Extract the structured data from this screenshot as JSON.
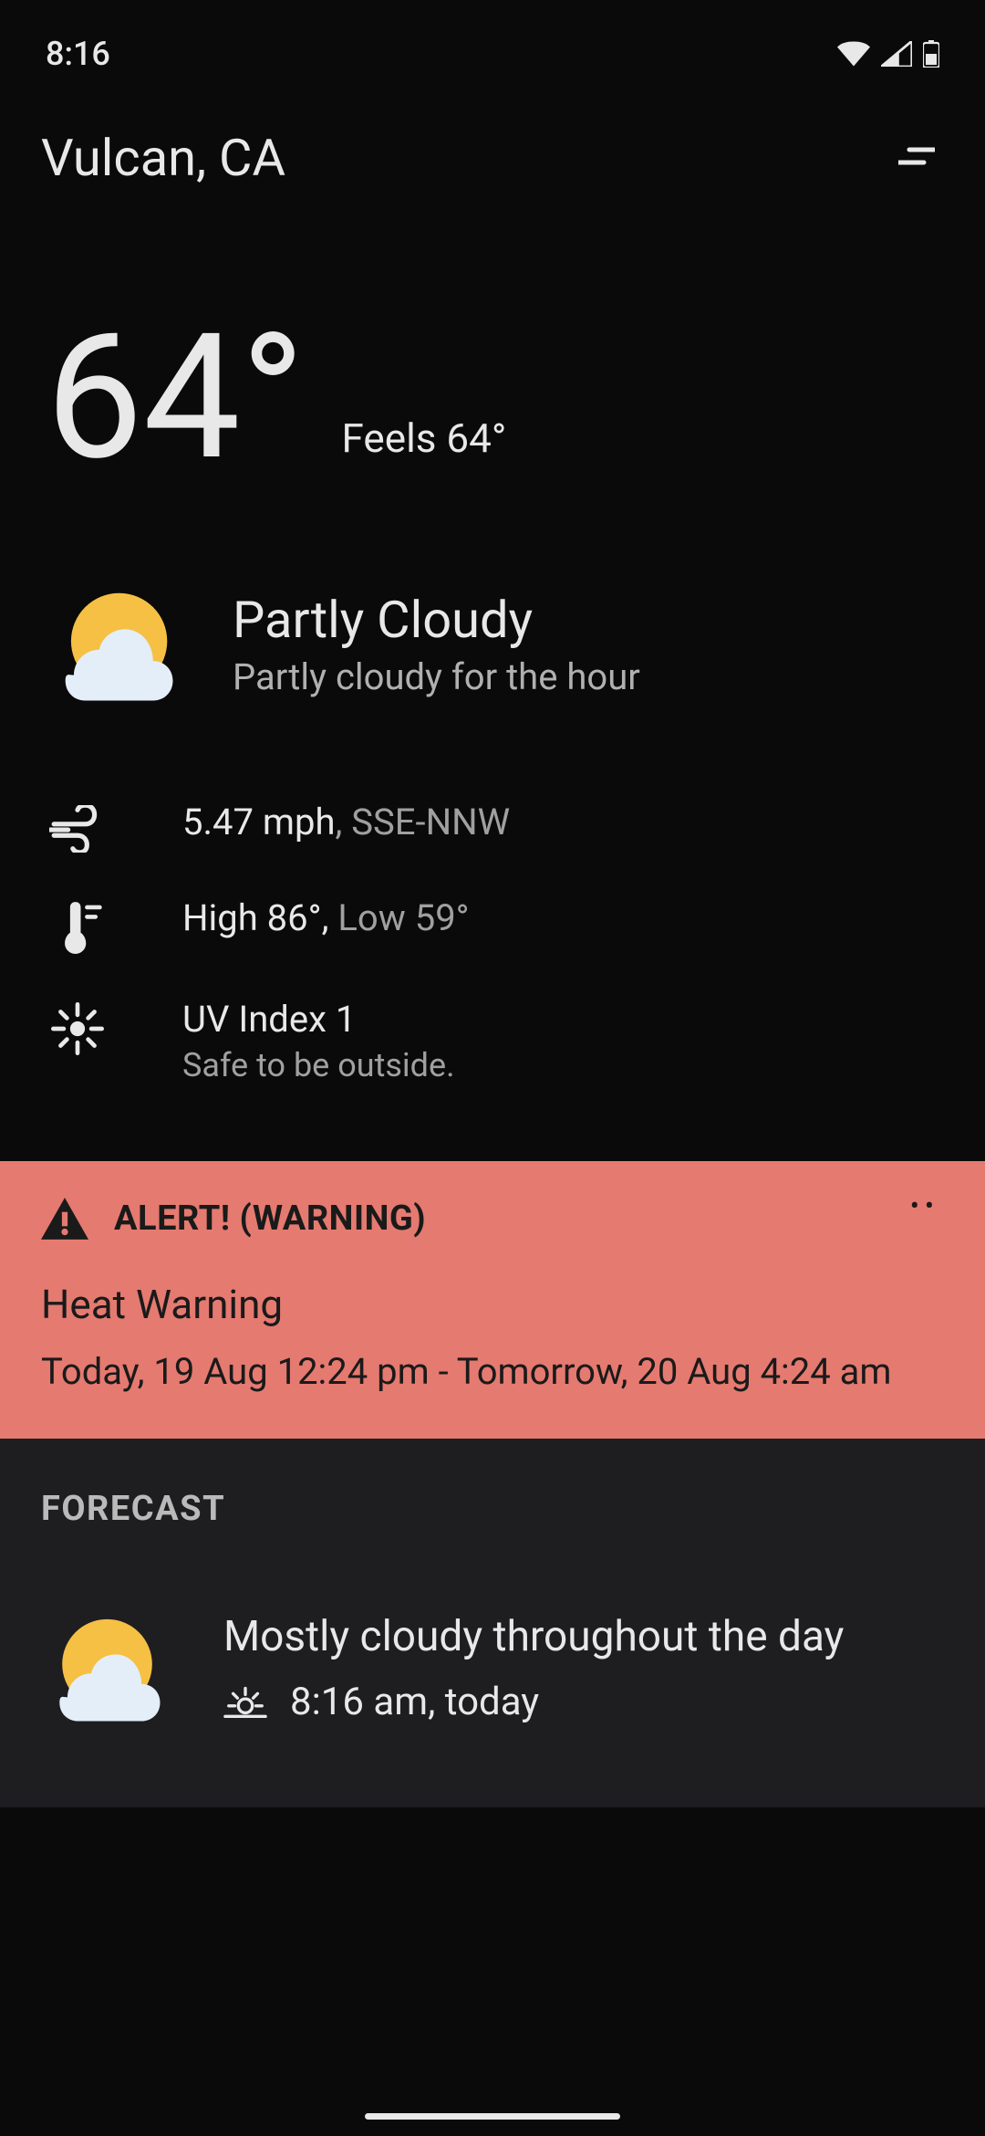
{
  "statusBar": {
    "time": "8:16"
  },
  "header": {
    "location": "Vulcan, CA"
  },
  "temperature": {
    "current": "64°",
    "feelsLike": "Feels 64°"
  },
  "condition": {
    "title": "Partly Cloudy",
    "subtitle": "Partly cloudy for the hour"
  },
  "details": {
    "wind": {
      "speed": "5.47 mph",
      "direction": ", SSE-NNW"
    },
    "temp": {
      "high": "High 86°,  ",
      "low": "Low 59°"
    },
    "uv": {
      "label": "UV Index  ",
      "value": "1",
      "note": "Safe to be outside."
    }
  },
  "alert": {
    "title": "ALERT! (WARNING)",
    "subtitle": "Heat Warning",
    "time": "Today,  19 Aug 12:24 pm - Tomorrow,  20 Aug 4:24 am"
  },
  "forecast": {
    "header": "FORECAST",
    "summary": "Mostly cloudy throughout the day",
    "time": "8:16 am, today"
  }
}
